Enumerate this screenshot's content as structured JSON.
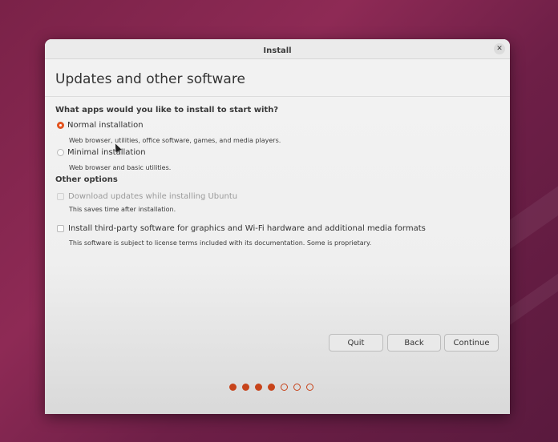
{
  "window": {
    "title": "Install"
  },
  "page_title": "Updates and other software",
  "apps_question": "What apps would you like to install to start with?",
  "install_options": [
    {
      "label": "Normal installation",
      "description": "Web browser, utilities, office software, games, and media players.",
      "selected": true
    },
    {
      "label": "Minimal installation",
      "description": "Web browser and basic utilities.",
      "selected": false
    }
  ],
  "other_options_heading": "Other options",
  "other_options": [
    {
      "label": "Download updates while installing Ubuntu",
      "description": "This saves time after installation.",
      "checked": false,
      "disabled": true
    },
    {
      "label": "Install third-party software for graphics and Wi-Fi hardware and additional media formats",
      "description": "This software is subject to license terms included with its documentation. Some is proprietary.",
      "checked": false,
      "disabled": false
    }
  ],
  "buttons": {
    "quit": "Quit",
    "back": "Back",
    "continue": "Continue"
  },
  "progress": {
    "total_steps": 7,
    "completed_steps": 4
  },
  "colors": {
    "accent": "#e95420",
    "progress_dot": "#c7441b"
  },
  "icons": {
    "close": "close-icon"
  }
}
